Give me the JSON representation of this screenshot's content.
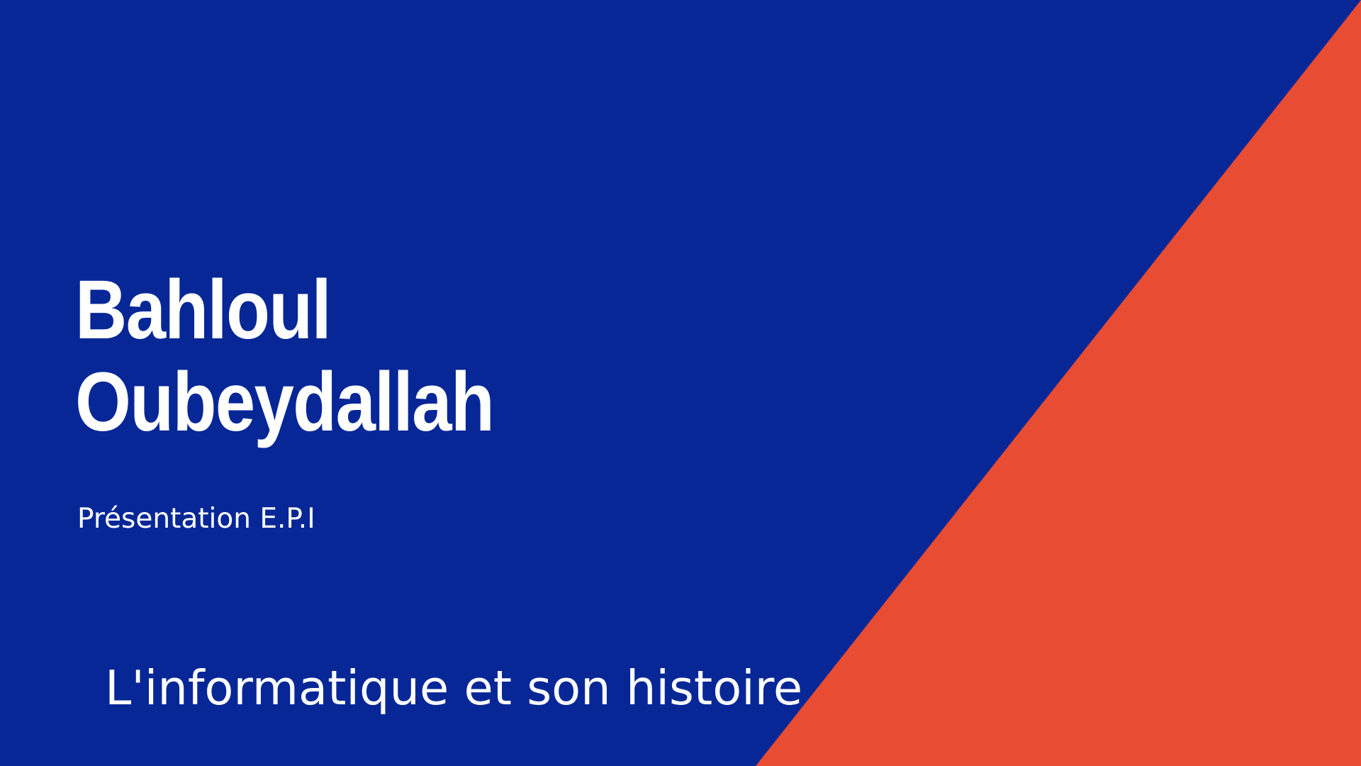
{
  "slide": {
    "title_line_1": "Bahloul",
    "title_line_2": "Oubeydallah",
    "subtitle": "Présentation E.P.I",
    "topic": "L'informatique et son histoire"
  },
  "colors": {
    "background": "#072797",
    "accent": "#E84C33",
    "text": "#FFFFFF"
  }
}
